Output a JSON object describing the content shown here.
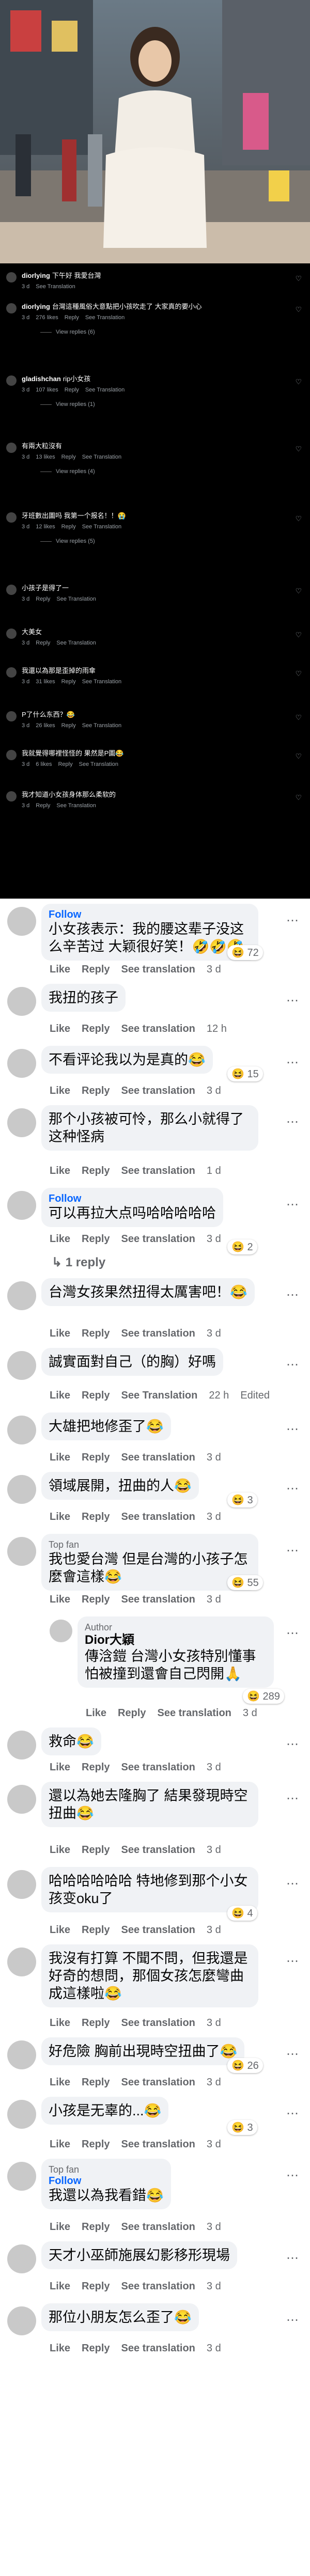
{
  "ig_comments": [
    {
      "user": "diorlying",
      "text": "下午好 我愛台灣",
      "meta": [
        "3 d",
        "See Translation"
      ]
    },
    {
      "user": "diorlying",
      "text": "台灣這種風俗大意點把小孩吹走了 大家真的要小心",
      "meta": [
        "3 d",
        "276 likes",
        "Reply",
        "See Translation"
      ],
      "more": "View replies (6)"
    },
    {
      "user": "gladishchan",
      "text": "rip小女孩",
      "meta": [
        "3 d",
        "107 likes",
        "Reply",
        "See Translation"
      ],
      "more": "View replies (1)"
    },
    {
      "user": "",
      "text": "有兩大粒沒有",
      "meta": [
        "3 d",
        "13 likes",
        "Reply",
        "See Translation"
      ],
      "more": "View replies (4)"
    },
    {
      "user": "",
      "text": "牙班數出圖吗 我第一个报名！！😭",
      "meta": [
        "3 d",
        "12 likes",
        "Reply",
        "See Translation"
      ],
      "more": "View replies (5)"
    },
    {
      "user": "",
      "text": "小孩子是得了一",
      "meta": [
        "3 d",
        "Reply",
        "See Translation"
      ]
    },
    {
      "user": "",
      "text": "大美女",
      "meta": [
        "3 d",
        "Reply",
        "See Translation"
      ]
    },
    {
      "user": "",
      "text": "我還以為那是歪掉的雨傘",
      "meta": [
        "3 d",
        "31 likes",
        "Reply",
        "See Translation"
      ]
    },
    {
      "user": "",
      "text": "P了什么东西？😂",
      "meta": [
        "3 d",
        "26 likes",
        "Reply",
        "See Translation"
      ]
    },
    {
      "user": "",
      "text": "我就覺得哪裡怪怪的 果然是P圖😂",
      "meta": [
        "3 d",
        "6 likes",
        "Reply",
        "See Translation"
      ]
    },
    {
      "user": "",
      "text": "我才知道小女孩身体那么柔软的",
      "meta": [
        "3 d",
        "Reply",
        "See Translation"
      ]
    }
  ],
  "fb_comments": [
    {
      "follow": "Follow",
      "text": "小女孩表示：我的腰这辈子没这么辛苦过 大颖很好笑！🤣🤣🤣",
      "actions": [
        "Like",
        "Reply",
        "See translation",
        "3 d"
      ],
      "react": "72"
    },
    {
      "text": "我扭的孩子",
      "actions": [
        "Like",
        "Reply",
        "See translation",
        "12 h"
      ]
    },
    {
      "text": "不看评论我以为是真的😂",
      "actions": [
        "Like",
        "Reply",
        "See translation",
        "3 d"
      ],
      "react": "15"
    },
    {
      "text": "那个小孩被可怜，那么小就得了这种怪病",
      "actions": [
        "Like",
        "Reply",
        "See translation",
        "1 d"
      ]
    },
    {
      "follow": "Follow",
      "text": "可以再拉大点吗哈哈哈哈哈",
      "actions": [
        "Like",
        "Reply",
        "See translation",
        "3 d"
      ],
      "react": "2",
      "more": "1 reply"
    },
    {
      "text": "台灣女孩果然扭得太厲害吧！😂",
      "actions": [
        "Like",
        "Reply",
        "See translation",
        "3 d"
      ]
    },
    {
      "text": "誠實面對自己（的胸）好嗎",
      "actions": [
        "Like",
        "Reply",
        "See Translation",
        "22 h",
        "Edited"
      ]
    },
    {
      "text": "大雄把地修歪了😂",
      "actions": [
        "Like",
        "Reply",
        "See translation",
        "3 d"
      ]
    },
    {
      "text": "領域展開，扭曲的人😂",
      "actions": [
        "Like",
        "Reply",
        "See translation",
        "3 d"
      ],
      "react": "3"
    },
    {
      "topfan": "Top fan",
      "text": "我也愛台灣 但是台灣的小孩子怎麼會這樣😂",
      "actions": [
        "Like",
        "Reply",
        "See translation",
        "3 d"
      ],
      "react": "55"
    },
    {
      "author": "Author",
      "name": "Dior大穎",
      "text": "傳浛鎧 台灣小女孩特別懂事 怕被撞到還會自己閃開🙏",
      "actions": [
        "Like",
        "Reply",
        "See translation",
        "3 d"
      ],
      "react": "289"
    },
    {
      "text": "救命😂",
      "actions": [
        "Like",
        "Reply",
        "See translation",
        "3 d"
      ]
    },
    {
      "text": "還以為她去隆胸了 結果發現時空扭曲😂",
      "actions": [
        "Like",
        "Reply",
        "See translation",
        "3 d"
      ]
    },
    {
      "text": "哈哈哈哈哈哈 特地修到那个小女孩变oku了",
      "actions": [
        "Like",
        "Reply",
        "See translation",
        "3 d"
      ],
      "react": "4"
    },
    {
      "text": "我沒有打算 不聞不問，但我還是好奇的想問，那個女孩怎麼彎曲成這樣啦😂",
      "actions": [
        "Like",
        "Reply",
        "See translation",
        "3 d"
      ]
    },
    {
      "text": "好危險 胸前出現時空扭曲了😂",
      "actions": [
        "Like",
        "Reply",
        "See translation",
        "3 d"
      ],
      "react": "26"
    },
    {
      "text": "小孩是无辜的...😂",
      "actions": [
        "Like",
        "Reply",
        "See translation",
        "3 d"
      ],
      "react": "3"
    },
    {
      "topfan": "Top fan",
      "follow": "Follow",
      "text": "我還以為我看錯😂",
      "actions": [
        "Like",
        "Reply",
        "See translation",
        "3 d"
      ]
    },
    {
      "text": "天才小巫師施展幻影移形現場",
      "actions": [
        "Like",
        "Reply",
        "See translation",
        "3 d"
      ]
    },
    {
      "text": "那位小朋友怎么歪了😂",
      "actions": [
        "Like",
        "Reply",
        "See translation",
        "3 d"
      ]
    }
  ]
}
